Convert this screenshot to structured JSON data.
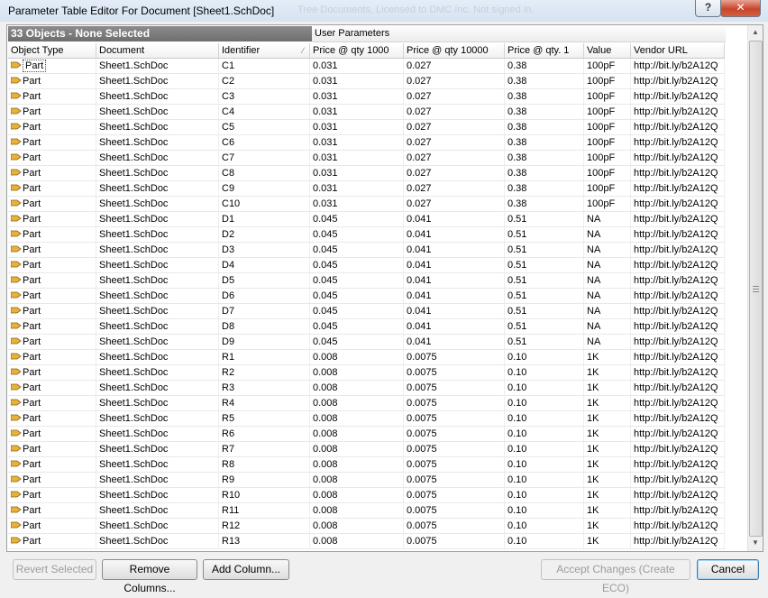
{
  "window": {
    "title": "Parameter Table Editor For Document [Sheet1.SchDoc]",
    "background_text": "Tree Documents, Licensed to DMC Inc. Not signed in."
  },
  "grid": {
    "banner": "33 Objects - None Selected",
    "user_parameters": "User Parameters",
    "headers": [
      "Object Type",
      "Document",
      "Identifier",
      "Price @ qty 1000",
      "Price @ qty 10000",
      "Price @ qty. 1",
      "Value",
      "Vendor URL"
    ],
    "rows": [
      {
        "type": "Part",
        "doc": "Sheet1.SchDoc",
        "id": "C1",
        "p1000": "0.031",
        "p10000": "0.027",
        "p1": "0.38",
        "value": "100pF",
        "url": "http://bit.ly/b2A12Q"
      },
      {
        "type": "Part",
        "doc": "Sheet1.SchDoc",
        "id": "C2",
        "p1000": "0.031",
        "p10000": "0.027",
        "p1": "0.38",
        "value": "100pF",
        "url": "http://bit.ly/b2A12Q"
      },
      {
        "type": "Part",
        "doc": "Sheet1.SchDoc",
        "id": "C3",
        "p1000": "0.031",
        "p10000": "0.027",
        "p1": "0.38",
        "value": "100pF",
        "url": "http://bit.ly/b2A12Q"
      },
      {
        "type": "Part",
        "doc": "Sheet1.SchDoc",
        "id": "C4",
        "p1000": "0.031",
        "p10000": "0.027",
        "p1": "0.38",
        "value": "100pF",
        "url": "http://bit.ly/b2A12Q"
      },
      {
        "type": "Part",
        "doc": "Sheet1.SchDoc",
        "id": "C5",
        "p1000": "0.031",
        "p10000": "0.027",
        "p1": "0.38",
        "value": "100pF",
        "url": "http://bit.ly/b2A12Q"
      },
      {
        "type": "Part",
        "doc": "Sheet1.SchDoc",
        "id": "C6",
        "p1000": "0.031",
        "p10000": "0.027",
        "p1": "0.38",
        "value": "100pF",
        "url": "http://bit.ly/b2A12Q"
      },
      {
        "type": "Part",
        "doc": "Sheet1.SchDoc",
        "id": "C7",
        "p1000": "0.031",
        "p10000": "0.027",
        "p1": "0.38",
        "value": "100pF",
        "url": "http://bit.ly/b2A12Q"
      },
      {
        "type": "Part",
        "doc": "Sheet1.SchDoc",
        "id": "C8",
        "p1000": "0.031",
        "p10000": "0.027",
        "p1": "0.38",
        "value": "100pF",
        "url": "http://bit.ly/b2A12Q"
      },
      {
        "type": "Part",
        "doc": "Sheet1.SchDoc",
        "id": "C9",
        "p1000": "0.031",
        "p10000": "0.027",
        "p1": "0.38",
        "value": "100pF",
        "url": "http://bit.ly/b2A12Q"
      },
      {
        "type": "Part",
        "doc": "Sheet1.SchDoc",
        "id": "C10",
        "p1000": "0.031",
        "p10000": "0.027",
        "p1": "0.38",
        "value": "100pF",
        "url": "http://bit.ly/b2A12Q"
      },
      {
        "type": "Part",
        "doc": "Sheet1.SchDoc",
        "id": "D1",
        "p1000": "0.045",
        "p10000": "0.041",
        "p1": "0.51",
        "value": "NA",
        "url": "http://bit.ly/b2A12Q"
      },
      {
        "type": "Part",
        "doc": "Sheet1.SchDoc",
        "id": "D2",
        "p1000": "0.045",
        "p10000": "0.041",
        "p1": "0.51",
        "value": "NA",
        "url": "http://bit.ly/b2A12Q"
      },
      {
        "type": "Part",
        "doc": "Sheet1.SchDoc",
        "id": "D3",
        "p1000": "0.045",
        "p10000": "0.041",
        "p1": "0.51",
        "value": "NA",
        "url": "http://bit.ly/b2A12Q"
      },
      {
        "type": "Part",
        "doc": "Sheet1.SchDoc",
        "id": "D4",
        "p1000": "0.045",
        "p10000": "0.041",
        "p1": "0.51",
        "value": "NA",
        "url": "http://bit.ly/b2A12Q"
      },
      {
        "type": "Part",
        "doc": "Sheet1.SchDoc",
        "id": "D5",
        "p1000": "0.045",
        "p10000": "0.041",
        "p1": "0.51",
        "value": "NA",
        "url": "http://bit.ly/b2A12Q"
      },
      {
        "type": "Part",
        "doc": "Sheet1.SchDoc",
        "id": "D6",
        "p1000": "0.045",
        "p10000": "0.041",
        "p1": "0.51",
        "value": "NA",
        "url": "http://bit.ly/b2A12Q"
      },
      {
        "type": "Part",
        "doc": "Sheet1.SchDoc",
        "id": "D7",
        "p1000": "0.045",
        "p10000": "0.041",
        "p1": "0.51",
        "value": "NA",
        "url": "http://bit.ly/b2A12Q"
      },
      {
        "type": "Part",
        "doc": "Sheet1.SchDoc",
        "id": "D8",
        "p1000": "0.045",
        "p10000": "0.041",
        "p1": "0.51",
        "value": "NA",
        "url": "http://bit.ly/b2A12Q"
      },
      {
        "type": "Part",
        "doc": "Sheet1.SchDoc",
        "id": "D9",
        "p1000": "0.045",
        "p10000": "0.041",
        "p1": "0.51",
        "value": "NA",
        "url": "http://bit.ly/b2A12Q"
      },
      {
        "type": "Part",
        "doc": "Sheet1.SchDoc",
        "id": "R1",
        "p1000": "0.008",
        "p10000": "0.0075",
        "p1": "0.10",
        "value": "1K",
        "url": "http://bit.ly/b2A12Q"
      },
      {
        "type": "Part",
        "doc": "Sheet1.SchDoc",
        "id": "R2",
        "p1000": "0.008",
        "p10000": "0.0075",
        "p1": "0.10",
        "value": "1K",
        "url": "http://bit.ly/b2A12Q"
      },
      {
        "type": "Part",
        "doc": "Sheet1.SchDoc",
        "id": "R3",
        "p1000": "0.008",
        "p10000": "0.0075",
        "p1": "0.10",
        "value": "1K",
        "url": "http://bit.ly/b2A12Q"
      },
      {
        "type": "Part",
        "doc": "Sheet1.SchDoc",
        "id": "R4",
        "p1000": "0.008",
        "p10000": "0.0075",
        "p1": "0.10",
        "value": "1K",
        "url": "http://bit.ly/b2A12Q"
      },
      {
        "type": "Part",
        "doc": "Sheet1.SchDoc",
        "id": "R5",
        "p1000": "0.008",
        "p10000": "0.0075",
        "p1": "0.10",
        "value": "1K",
        "url": "http://bit.ly/b2A12Q"
      },
      {
        "type": "Part",
        "doc": "Sheet1.SchDoc",
        "id": "R6",
        "p1000": "0.008",
        "p10000": "0.0075",
        "p1": "0.10",
        "value": "1K",
        "url": "http://bit.ly/b2A12Q"
      },
      {
        "type": "Part",
        "doc": "Sheet1.SchDoc",
        "id": "R7",
        "p1000": "0.008",
        "p10000": "0.0075",
        "p1": "0.10",
        "value": "1K",
        "url": "http://bit.ly/b2A12Q"
      },
      {
        "type": "Part",
        "doc": "Sheet1.SchDoc",
        "id": "R8",
        "p1000": "0.008",
        "p10000": "0.0075",
        "p1": "0.10",
        "value": "1K",
        "url": "http://bit.ly/b2A12Q"
      },
      {
        "type": "Part",
        "doc": "Sheet1.SchDoc",
        "id": "R9",
        "p1000": "0.008",
        "p10000": "0.0075",
        "p1": "0.10",
        "value": "1K",
        "url": "http://bit.ly/b2A12Q"
      },
      {
        "type": "Part",
        "doc": "Sheet1.SchDoc",
        "id": "R10",
        "p1000": "0.008",
        "p10000": "0.0075",
        "p1": "0.10",
        "value": "1K",
        "url": "http://bit.ly/b2A12Q"
      },
      {
        "type": "Part",
        "doc": "Sheet1.SchDoc",
        "id": "R11",
        "p1000": "0.008",
        "p10000": "0.0075",
        "p1": "0.10",
        "value": "1K",
        "url": "http://bit.ly/b2A12Q"
      },
      {
        "type": "Part",
        "doc": "Sheet1.SchDoc",
        "id": "R12",
        "p1000": "0.008",
        "p10000": "0.0075",
        "p1": "0.10",
        "value": "1K",
        "url": "http://bit.ly/b2A12Q"
      },
      {
        "type": "Part",
        "doc": "Sheet1.SchDoc",
        "id": "R13",
        "p1000": "0.008",
        "p10000": "0.0075",
        "p1": "0.10",
        "value": "1K",
        "url": "http://bit.ly/b2A12Q"
      }
    ]
  },
  "buttons": {
    "revert": "Revert Selected",
    "remove_columns": "Remove Columns...",
    "add_column": "Add Column...",
    "accept": "Accept Changes (Create ECO)",
    "cancel": "Cancel"
  },
  "icons": {
    "part": "part-icon",
    "help": "help-icon",
    "close": "close-icon",
    "sort": "sort-indicator-icon"
  },
  "colors": {
    "banner_bg": "#7d7d7d",
    "close_button": "#c8452c",
    "part_icon": "#e8b23a"
  }
}
